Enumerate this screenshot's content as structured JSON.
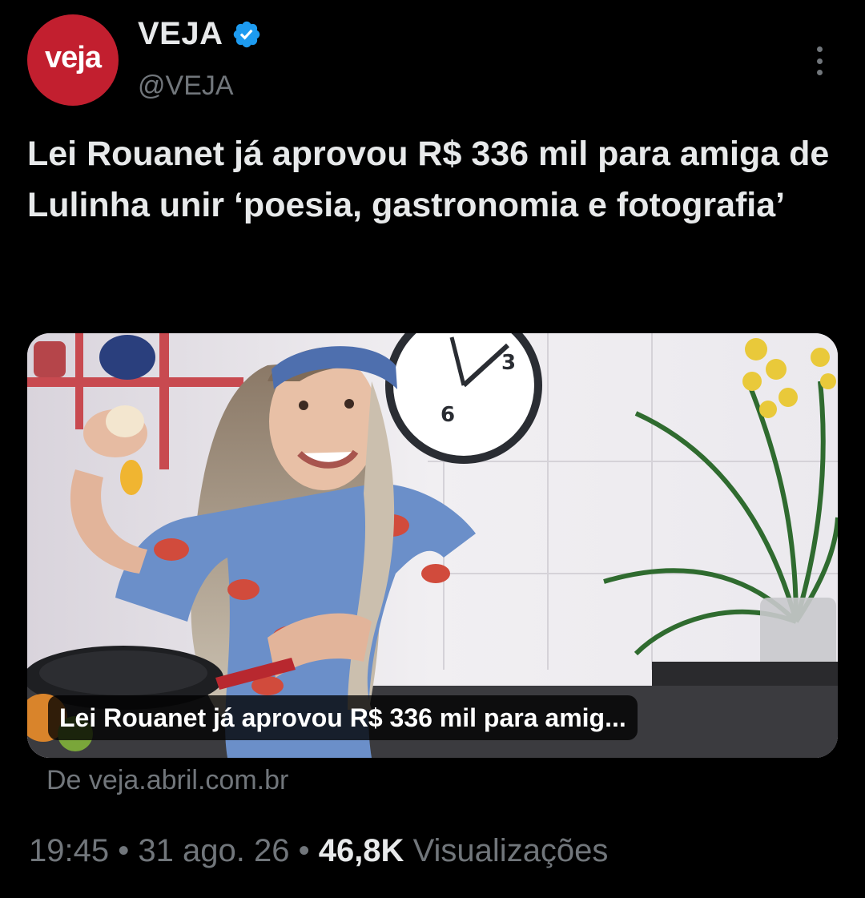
{
  "header": {
    "avatar_text": "veja",
    "display_name": "VEJA",
    "handle": "@VEJA",
    "verified_icon": "verified-badge-icon",
    "more_icon": "more-options-icon"
  },
  "tweet": {
    "text": "Lei Rouanet já aprovou R$ 336 mil para amiga de Lulinha unir ‘poesia, gastronomia e fotografia’"
  },
  "card": {
    "caption": "Lei Rouanet já aprovou R$ 336 mil para amig...",
    "source": "De veja.abril.com.br",
    "clock_numbers": [
      "3",
      "6"
    ]
  },
  "meta": {
    "time": "19:45",
    "separator": "•",
    "date": "31 ago. 26",
    "views_count": "46,8K",
    "views_label": "Visualizações"
  },
  "colors": {
    "background": "#000000",
    "primary_text": "#e7e9ea",
    "secondary_text": "#71767b",
    "avatar_red": "#c21f2f",
    "verified_blue": "#1d9bf0"
  }
}
